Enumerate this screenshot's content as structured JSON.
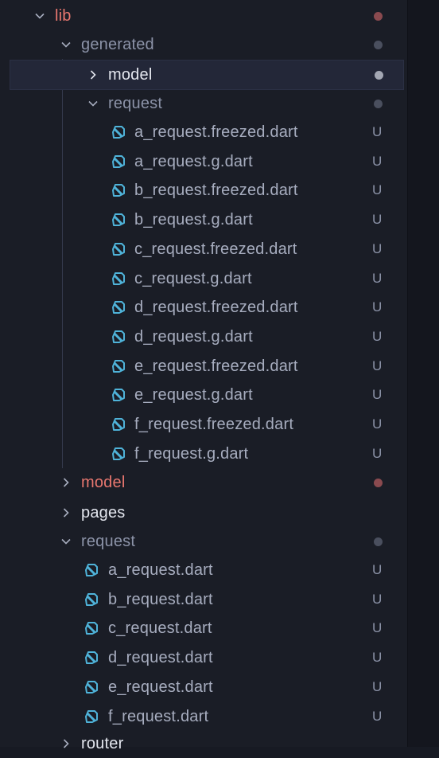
{
  "colors": {
    "background": "#1a1d26",
    "selection": "#232738",
    "folder_text": "#8c93a8",
    "modified_folder_text": "#e8776f",
    "file_text": "#a7adbf",
    "dart_icon": "#4fb3d9",
    "modified_dot": "#8a4a4f",
    "neutral_dot": "#5b6070"
  },
  "tree": {
    "lib": {
      "label": "lib",
      "expanded": true,
      "status": "modified-dot"
    },
    "generated": {
      "label": "generated",
      "expanded": true,
      "status": "dot"
    },
    "generated_model": {
      "label": "model",
      "expanded": false,
      "selected": true,
      "status": "dot"
    },
    "generated_request": {
      "label": "request",
      "expanded": true,
      "status": "dot"
    },
    "generated_request_files": [
      {
        "label": "a_request.freezed.dart",
        "status": "U"
      },
      {
        "label": "a_request.g.dart",
        "status": "U"
      },
      {
        "label": "b_request.freezed.dart",
        "status": "U"
      },
      {
        "label": "b_request.g.dart",
        "status": "U"
      },
      {
        "label": "c_request.freezed.dart",
        "status": "U"
      },
      {
        "label": "c_request.g.dart",
        "status": "U"
      },
      {
        "label": "d_request.freezed.dart",
        "status": "U"
      },
      {
        "label": "d_request.g.dart",
        "status": "U"
      },
      {
        "label": "e_request.freezed.dart",
        "status": "U"
      },
      {
        "label": "e_request.g.dart",
        "status": "U"
      },
      {
        "label": "f_request.freezed.dart",
        "status": "U"
      },
      {
        "label": "f_request.g.dart",
        "status": "U"
      }
    ],
    "model": {
      "label": "model",
      "expanded": false,
      "status": "modified-dot"
    },
    "pages": {
      "label": "pages",
      "expanded": false
    },
    "request": {
      "label": "request",
      "expanded": true,
      "status": "dot"
    },
    "request_files": [
      {
        "label": "a_request.dart",
        "status": "U"
      },
      {
        "label": "b_request.dart",
        "status": "U"
      },
      {
        "label": "c_request.dart",
        "status": "U"
      },
      {
        "label": "d_request.dart",
        "status": "U"
      },
      {
        "label": "e_request.dart",
        "status": "U"
      },
      {
        "label": "f_request.dart",
        "status": "U"
      }
    ],
    "router": {
      "label": "router",
      "expanded": false
    }
  }
}
